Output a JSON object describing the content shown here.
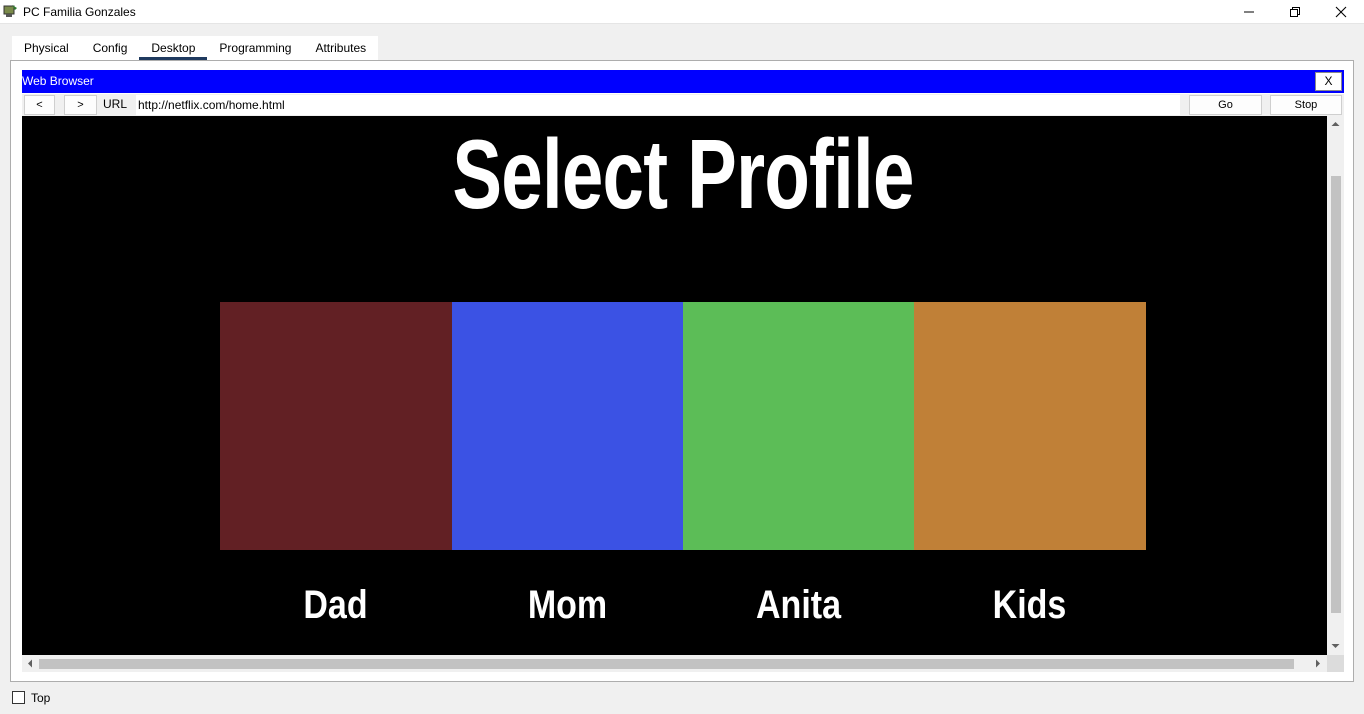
{
  "window": {
    "title": "PC Familia Gonzales",
    "controls": [
      "minimize-icon",
      "restore-icon",
      "close-icon"
    ]
  },
  "tabs": [
    {
      "label": "Physical",
      "active": false
    },
    {
      "label": "Config",
      "active": false
    },
    {
      "label": "Desktop",
      "active": true
    },
    {
      "label": "Programming",
      "active": false
    },
    {
      "label": "Attributes",
      "active": false
    }
  ],
  "browser": {
    "title": "Web Browser",
    "close_label": "X",
    "back_label": "<",
    "forward_label": ">",
    "url_label": "URL",
    "url": "http://netflix.com/home.html",
    "go_label": "Go",
    "stop_label": "Stop"
  },
  "page": {
    "headline": "Select Profile",
    "profiles": [
      {
        "name": "Dad",
        "color": "#622024"
      },
      {
        "name": "Mom",
        "color": "#3b52e4"
      },
      {
        "name": "Anita",
        "color": "#5cbd57"
      },
      {
        "name": "Kids",
        "color": "#c08037"
      }
    ]
  },
  "footer": {
    "top_label": "Top",
    "top_checked": false
  },
  "colors": {
    "browser_titlebar": "#0000ff",
    "tab_active_underline": "#1f3a5f",
    "page_background": "#000000"
  }
}
